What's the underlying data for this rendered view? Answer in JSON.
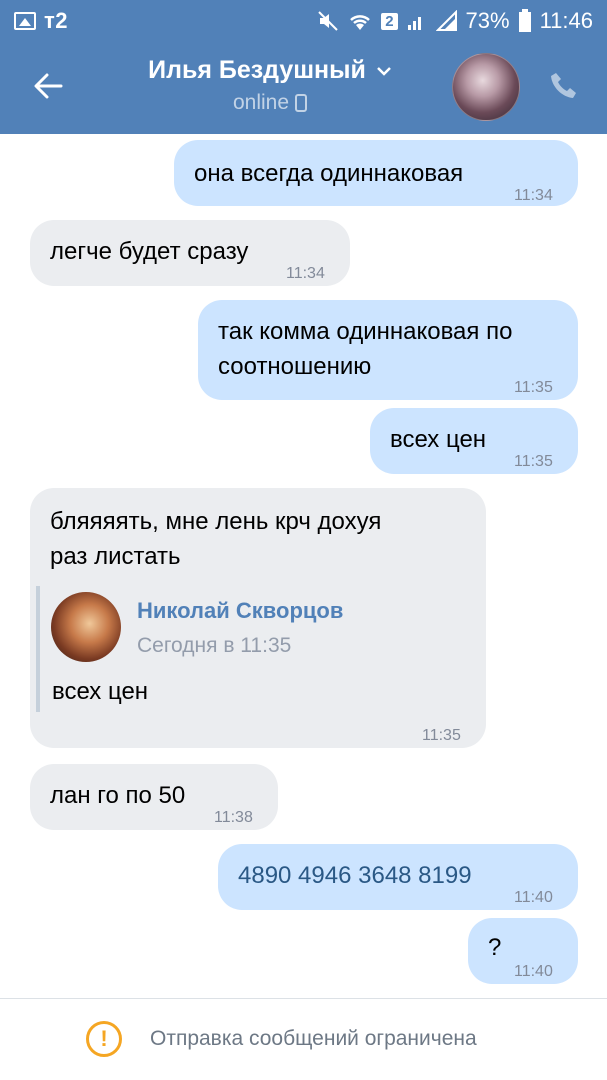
{
  "status_bar": {
    "carrier": "т2",
    "sim_badge": "2",
    "battery": "73%",
    "time": "11:46"
  },
  "header": {
    "contact_name": "Илья Бездушный",
    "status": "online"
  },
  "messages": [
    {
      "direction": "out",
      "text": "она всегда одиннаковая",
      "time": "11:34"
    },
    {
      "direction": "in",
      "text": "легче будет сразу",
      "time": "11:34"
    },
    {
      "direction": "out",
      "text_line1": "так комма одиннаковая по",
      "text_line2": "соотношению",
      "time": "11:35"
    },
    {
      "direction": "out",
      "text": "всех цен",
      "time": "11:35"
    },
    {
      "direction": "in",
      "text_line1": "бляяяять, мне лень крч дохуя",
      "text_line2": "раз листать",
      "time": "11:35",
      "forwarded": {
        "author": "Николай Скворцов",
        "date": "Сегодня в 11:35",
        "text": "всех цен"
      }
    },
    {
      "direction": "in",
      "text": "лан го по 50",
      "time": "11:38"
    },
    {
      "direction": "out",
      "text": "4890 4946 3648 8199",
      "time": "11:40"
    },
    {
      "direction": "out",
      "text": "?",
      "time": "11:40"
    }
  ],
  "footer": {
    "notice": "Отправка сообщений ограничена"
  },
  "colors": {
    "header_blue": "#5181b8",
    "outgoing_bubble": "#cce4ff",
    "incoming_bubble": "#ebedf0",
    "warning": "#f5a623"
  }
}
